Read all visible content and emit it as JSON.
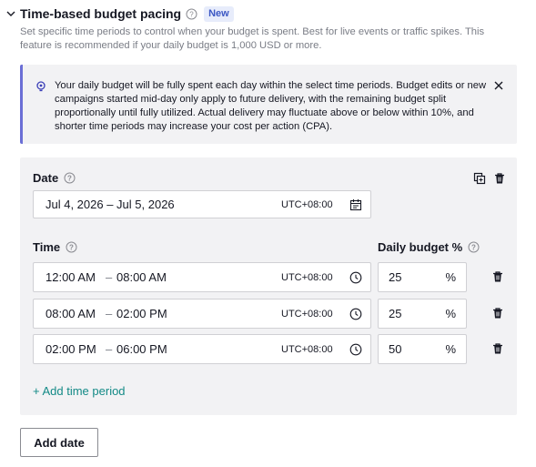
{
  "section": {
    "title": "Time-based budget pacing",
    "badge": "New",
    "description": "Set specific time periods to control when your budget is spent. Best for live events or traffic spikes. This feature is recommended if your daily budget is 1,000 USD or more."
  },
  "notice": {
    "text": "Your daily budget will be fully spent each day within the select time periods. Budget edits or new campaigns started mid-day only apply to future delivery, with the remaining budget split proportionally until fully utilized. Actual delivery may fluctuate above or below within 10%, and shorter time periods may increase your cost per action (CPA)."
  },
  "date": {
    "label": "Date",
    "value": "Jul 4, 2026 – Jul 5, 2026",
    "timezone": "UTC+08:00"
  },
  "time": {
    "label": "Time",
    "budget_label": "Daily budget %",
    "rows": [
      {
        "start": "12:00 AM",
        "end": "08:00 AM",
        "timezone": "UTC+08:00",
        "percent": "25",
        "percent_sign": "%"
      },
      {
        "start": "08:00 AM",
        "end": "02:00 PM",
        "timezone": "UTC+08:00",
        "percent": "25",
        "percent_sign": "%"
      },
      {
        "start": "02:00 PM",
        "end": "06:00 PM",
        "timezone": "UTC+08:00",
        "percent": "50",
        "percent_sign": "%"
      }
    ],
    "dash": "–"
  },
  "actions": {
    "add_period": "+ Add time period",
    "add_date": "Add date"
  },
  "colors": {
    "accent_link": "#138a86",
    "badge_bg": "#e7ecfb",
    "badge_text": "#3b57c4",
    "notice_border": "#6b6fd6",
    "panel_bg": "#f2f2f4"
  },
  "icons": [
    "chevron-down-icon",
    "help-icon",
    "lightbulb-icon",
    "close-icon",
    "copy-icon",
    "trash-icon",
    "calendar-icon",
    "clock-icon"
  ]
}
